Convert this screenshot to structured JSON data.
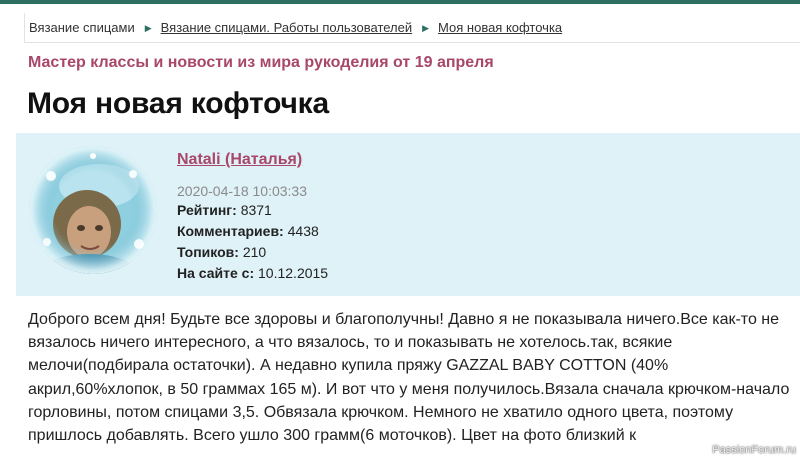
{
  "breadcrumb": {
    "items": [
      {
        "label": "Вязание спицами"
      },
      {
        "label": "Вязание спицами. Работы пользователей"
      },
      {
        "label": "Моя новая кофточка"
      }
    ]
  },
  "header": {
    "subtitle": "Мастер классы и новости из мира рукоделия от 19 апреля",
    "title": "Моя новая кофточка"
  },
  "author": {
    "name": "Natali (Наталья)",
    "date": "2020-04-18 10:03:33",
    "stats": [
      {
        "label": "Рейтинг:",
        "value": "8371"
      },
      {
        "label": "Комментариев:",
        "value": "4438"
      },
      {
        "label": "Топиков:",
        "value": "210"
      },
      {
        "label": "На сайте с:",
        "value": "10.12.2015"
      }
    ]
  },
  "post": {
    "text": "Доброго всем дня! Будьте все здоровы и благополучны!  Давно я не показывала ничего.Все как-то не вязалось ничего интересного, а что вязалось, то и показывать не хотелось.так, всякие мелочи(подбирала остаточки). А недавно купила  пряжу GAZZAL BABY COTTON (40% акрил,60%хлопок, в 50 граммах 165 м). И вот что у меня получилось.Вязала сначала крючком-начало горловины, потом спицами 3,5. Обвязала крючком. Немного не хватило одного цвета, поэтому пришлось добавлять. Всего ушло 300 грамм(6 моточков). Цвет на фото близкий к"
  },
  "watermark": "PassionForum.ru",
  "colors": {
    "accent": "#a8476a",
    "card_bg": "#dff2f8",
    "topbar": "#2f6f62"
  }
}
